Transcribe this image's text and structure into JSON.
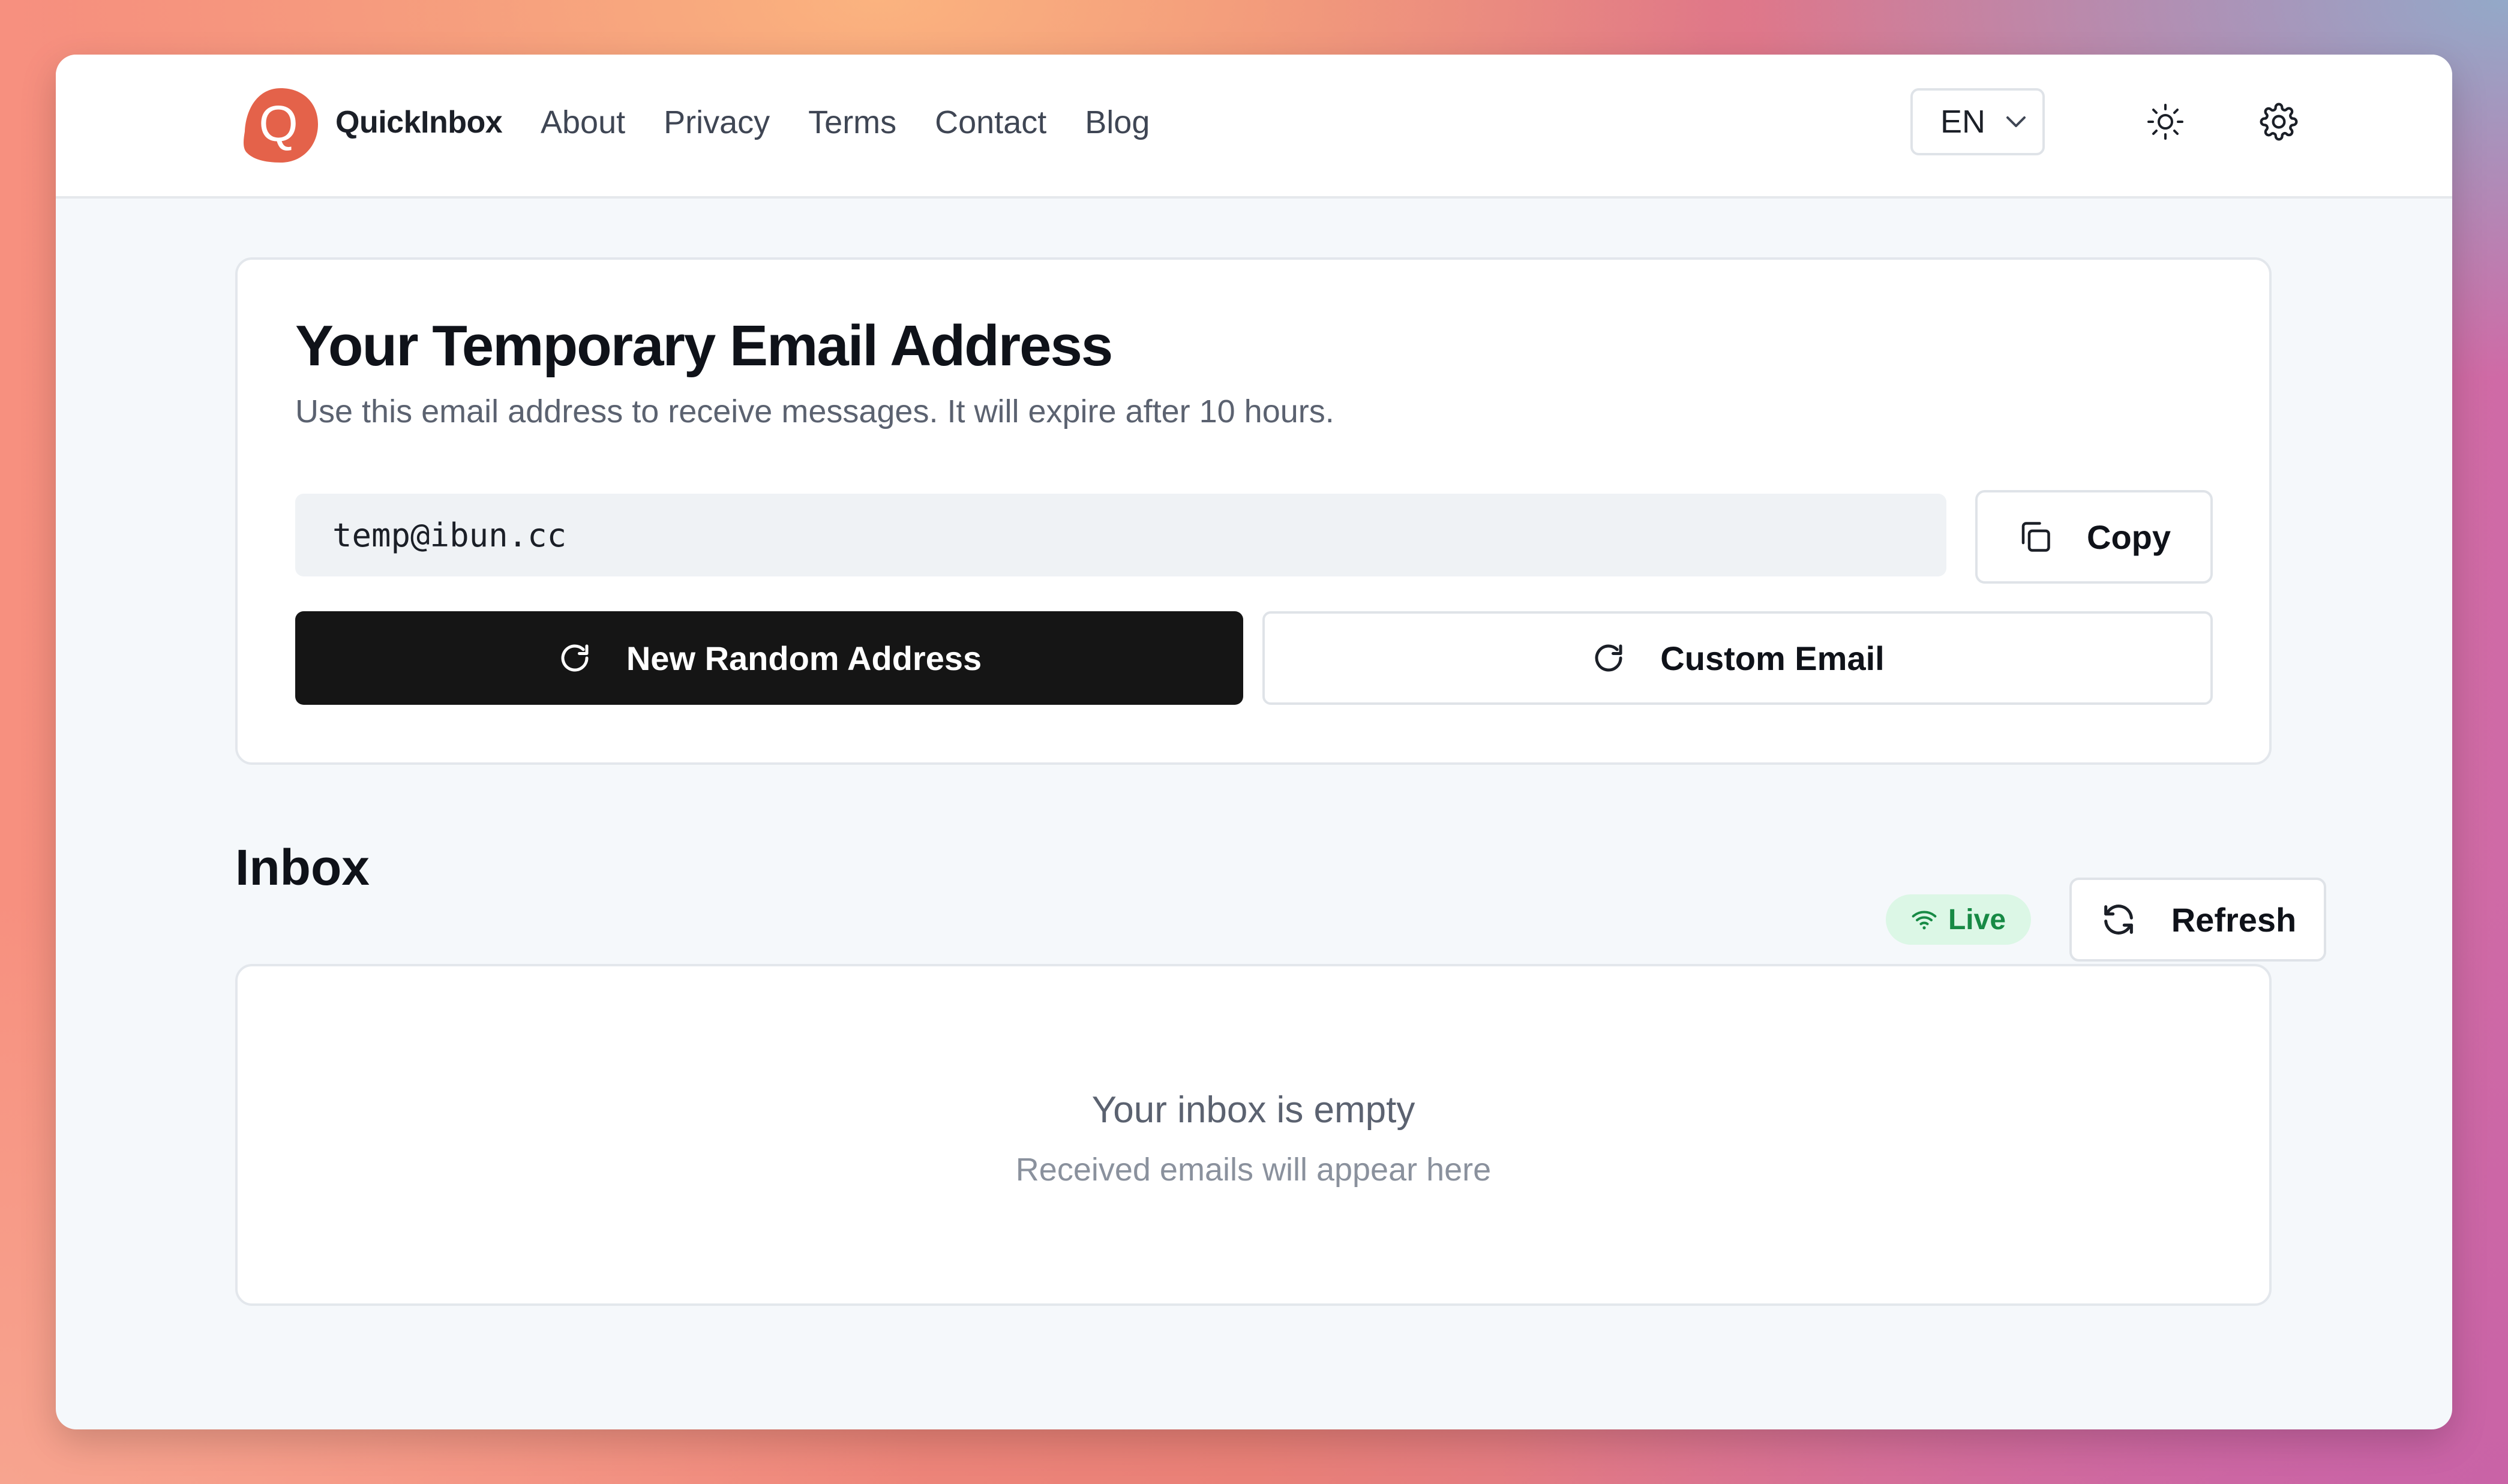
{
  "header": {
    "brand": "QuickInbox",
    "nav": [
      "About",
      "Privacy",
      "Terms",
      "Contact",
      "Blog"
    ],
    "language": "EN",
    "icons": {
      "logo": "q-logo-icon",
      "theme": "sun-icon",
      "settings": "gear-icon"
    }
  },
  "address_card": {
    "title": "Your Temporary Email Address",
    "subtitle": "Use this email address to receive messages. It will expire after 10 hours.",
    "email": "temp@ibun.cc",
    "copy_label": "Copy",
    "new_random_label": "New Random Address",
    "custom_label": "Custom Email"
  },
  "inbox": {
    "title": "Inbox",
    "live_label": "Live",
    "refresh_label": "Refresh",
    "empty_title": "Your inbox is empty",
    "empty_subtitle": "Received emails will appear here"
  },
  "colors": {
    "brand": "#e4624a",
    "primary_button": "#151515",
    "live_bg": "#dcf7e6",
    "live_text": "#178a45"
  }
}
